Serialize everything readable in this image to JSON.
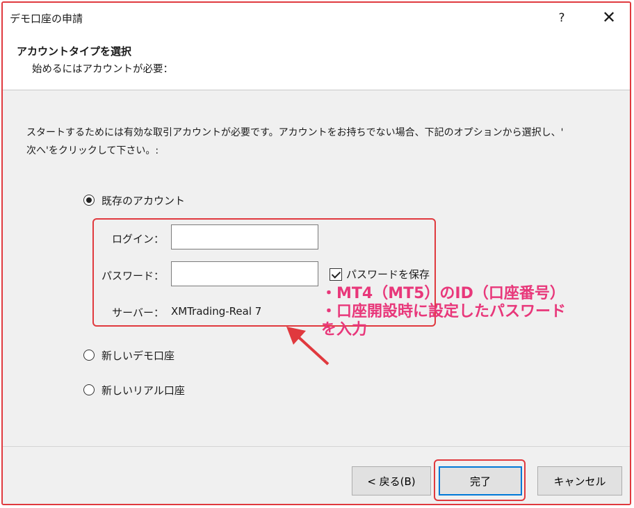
{
  "window": {
    "title": "デモ口座の申請",
    "help_label": "?",
    "close_label": "✕"
  },
  "header": {
    "title": "アカウントタイプを選択",
    "subtitle": "始めるにはアカウントが必要："
  },
  "description": {
    "line1": "スタートするためには有効な取引アカウントが必要です。アカウントをお持ちでない場合、下記のオプションから選択し、'",
    "line2": "次へ'をクリックして下さい。:"
  },
  "options": {
    "existing": {
      "label": "既存のアカウント",
      "selected": true
    },
    "new_demo": {
      "label": "新しいデモ口座",
      "selected": false
    },
    "new_real": {
      "label": "新しいリアル口座",
      "selected": false
    }
  },
  "form": {
    "login_label": "ログイン：",
    "login_value": "",
    "password_label": "パスワード：",
    "password_value": "",
    "save_password_label": "パスワードを保存",
    "save_password_checked": true,
    "server_label": "サーバー：",
    "server_value": "XMTrading-Real 7"
  },
  "annotation": {
    "line1": "・MT4（MT5）のID（口座番号）",
    "line2": "・口座開設時に設定したパスワード",
    "line3": "を入力",
    "color": "#e8377a"
  },
  "buttons": {
    "back": "< 戻る(B)",
    "finish": "完了",
    "cancel": "キャンセル"
  },
  "colors": {
    "highlight": "#e0393e",
    "primary_border": "#0078d7"
  }
}
